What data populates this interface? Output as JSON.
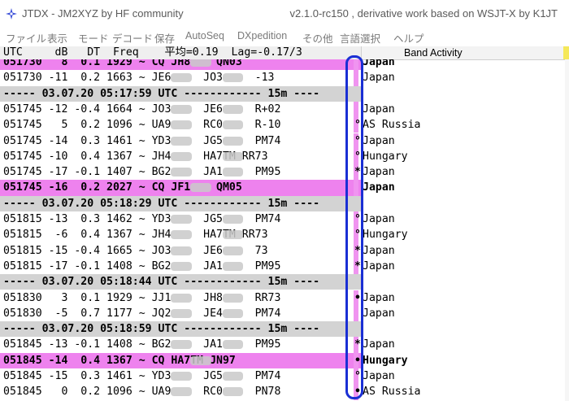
{
  "window": {
    "title": "JTDX - JM2XYZ  by HF community",
    "version": "v2.1.0-rc150 , derivative work based on WSJT-X by K1JT"
  },
  "menu": [
    "ファイル",
    "表示",
    "モード",
    "デコード",
    "保存",
    "AutoSeq",
    "DXpedition",
    "その他",
    "言語選択",
    "ヘルプ"
  ],
  "column_header": "UTC     dB   DT  Freq    平均=0.19  Lag=-0.17/3",
  "band_activity_label": "Band Activity",
  "rows": [
    {
      "type": "cq",
      "text": "051730   8  0.1 1929 ~ CQ JH8    QN03",
      "mark": "",
      "country": "Japan"
    },
    {
      "type": "msg",
      "text": "051730 -11  0.2 1663 ~ JE6     JO3     -13",
      "mark": "",
      "country": "Japan"
    },
    {
      "type": "sep",
      "text": "----- 03.07.20 05:17:59 UTC ------------ 15m ----",
      "mark": "",
      "country": ""
    },
    {
      "type": "msg",
      "text": "051745 -12 -0.4 1664 ~ JO3     JE6     R+02",
      "mark": "",
      "country": "Japan"
    },
    {
      "type": "msg",
      "text": "051745   5  0.2 1096 ~ UA9     RC0     R-10",
      "mark": "°",
      "country": "AS Russia"
    },
    {
      "type": "msg",
      "text": "051745 -14  0.3 1461 ~ YD3     JG5     PM74",
      "mark": "°",
      "country": "Japan"
    },
    {
      "type": "msg",
      "text": "051745 -10  0.4 1367 ~ JH4     HA7TM RR73",
      "mark": "°",
      "country": "Hungary"
    },
    {
      "type": "msg",
      "text": "051745 -17 -0.1 1407 ~ BG2     JA1     PM95",
      "mark": "*",
      "country": "Japan"
    },
    {
      "type": "cq",
      "text": "051745 -16  0.2 2027 ~ CQ JF1    QM05",
      "mark": "",
      "country": "Japan"
    },
    {
      "type": "sep",
      "text": "----- 03.07.20 05:18:29 UTC ------------ 15m ----",
      "mark": "",
      "country": ""
    },
    {
      "type": "msg",
      "text": "051815 -13  0.3 1462 ~ YD3     JG5     PM74",
      "mark": "°",
      "country": "Japan"
    },
    {
      "type": "msg",
      "text": "051815  -6  0.4 1367 ~ JH4     HA7TM RR73",
      "mark": "°",
      "country": "Hungary"
    },
    {
      "type": "msg",
      "text": "051815 -15 -0.4 1665 ~ JO3     JE6     73",
      "mark": "*",
      "country": "Japan"
    },
    {
      "type": "msg",
      "text": "051815 -17 -0.1 1408 ~ BG2     JA1     PM95",
      "mark": "*",
      "country": "Japan"
    },
    {
      "type": "sep",
      "text": "----- 03.07.20 05:18:44 UTC ------------ 15m ----",
      "mark": "",
      "country": ""
    },
    {
      "type": "msg",
      "text": "051830   3  0.1 1929 ~ JJ1     JH8     RR73",
      "mark": "•",
      "country": "Japan"
    },
    {
      "type": "msg",
      "text": "051830  -5  0.7 1177 ~ JQ2     JE4     PM74",
      "mark": "",
      "country": "Japan"
    },
    {
      "type": "sep",
      "text": "----- 03.07.20 05:18:59 UTC ------------ 15m ----",
      "mark": "",
      "country": ""
    },
    {
      "type": "msg",
      "text": "051845 -13 -0.1 1408 ~ BG2     JA1     PM95",
      "mark": "*",
      "country": "Japan"
    },
    {
      "type": "cq",
      "text": "051845 -14  0.4 1367 ~ CQ HA7TM JN97",
      "mark": "•",
      "country": "Hungary"
    },
    {
      "type": "msg",
      "text": "051845 -15  0.3 1461 ~ YD3     JG5     PM74",
      "mark": "°",
      "country": "Japan"
    },
    {
      "type": "msg",
      "text": "051845   0  0.2 1096 ~ UA9     RC0     PN78",
      "mark": "•",
      "country": "AS Russia"
    }
  ]
}
